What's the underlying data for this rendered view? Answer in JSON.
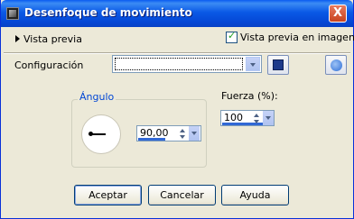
{
  "window": {
    "title": "Desenfoque de movimiento",
    "close_glyph": "X"
  },
  "preview": {
    "toggle_label": "Vista previa",
    "checkbox_label": "Vista previa en imagen",
    "checkbox_checked": true
  },
  "config": {
    "label": "Configuración",
    "preset_value": ""
  },
  "angle": {
    "group_label": "Ángulo",
    "value": "90,00"
  },
  "strength": {
    "label": "Fuerza (%):",
    "value": "100"
  },
  "buttons": {
    "ok": "Aceptar",
    "cancel": "Cancelar",
    "help": "Ayuda"
  },
  "colors": {
    "title_bar": "#0a59e6",
    "dialog_bg": "#ece9d8",
    "accent": "#3168d5"
  }
}
